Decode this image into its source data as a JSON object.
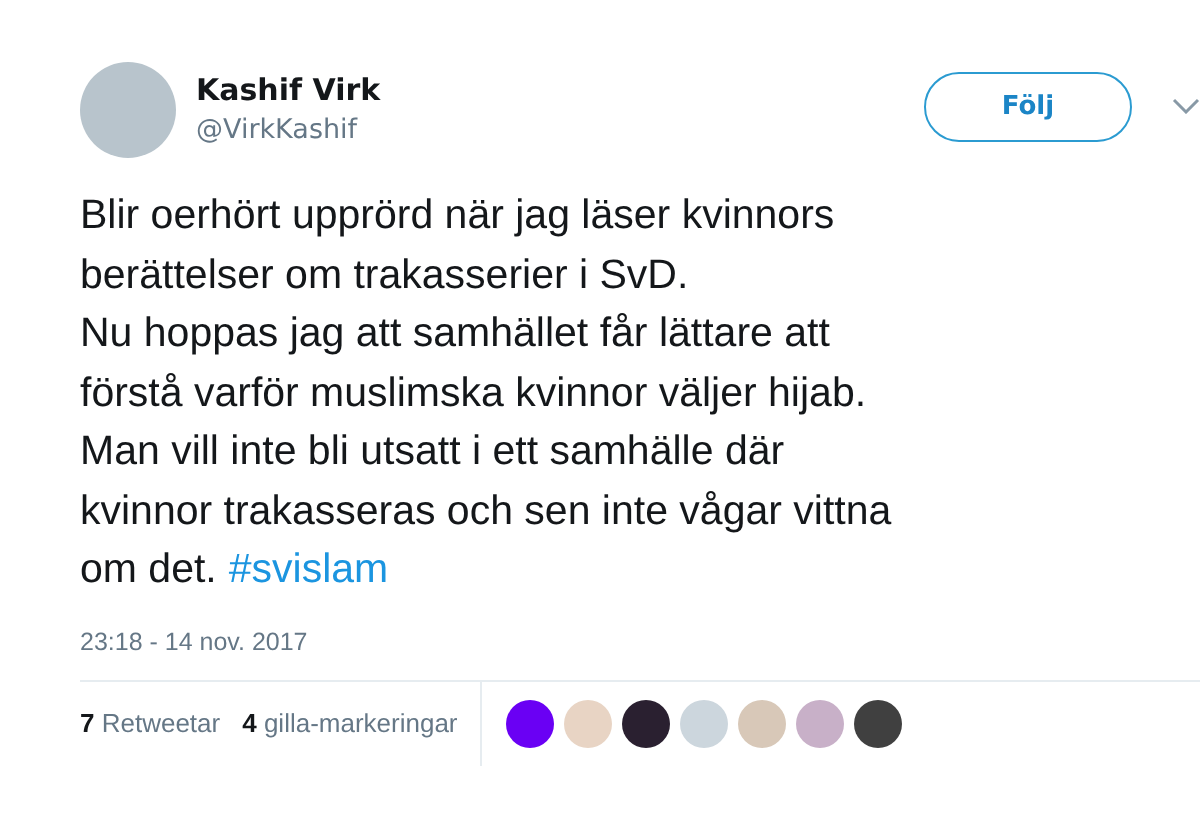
{
  "author": {
    "name": "Kashif Virk",
    "handle": "@VirkKashif"
  },
  "follow_button": "Följ",
  "body_lines": [
    "Blir oerhört upprörd när jag läser kvinnors",
    "berättelser om trakasserier i SvD.",
    "Nu hoppas jag att samhället får lättare att",
    "förstå varför muslimska kvinnor väljer hijab.",
    "Man vill inte bli utsatt i ett samhälle där",
    "kvinnor trakasseras och sen inte vågar vittna"
  ],
  "last_line": {
    "text": "om det.",
    "hashtag": "#svislam"
  },
  "timestamp": "23:18 - 14 nov. 2017",
  "stats": [
    {
      "count": "7",
      "label": "Retweetar"
    },
    {
      "count": "4",
      "label": "gilla-markeringar"
    }
  ]
}
